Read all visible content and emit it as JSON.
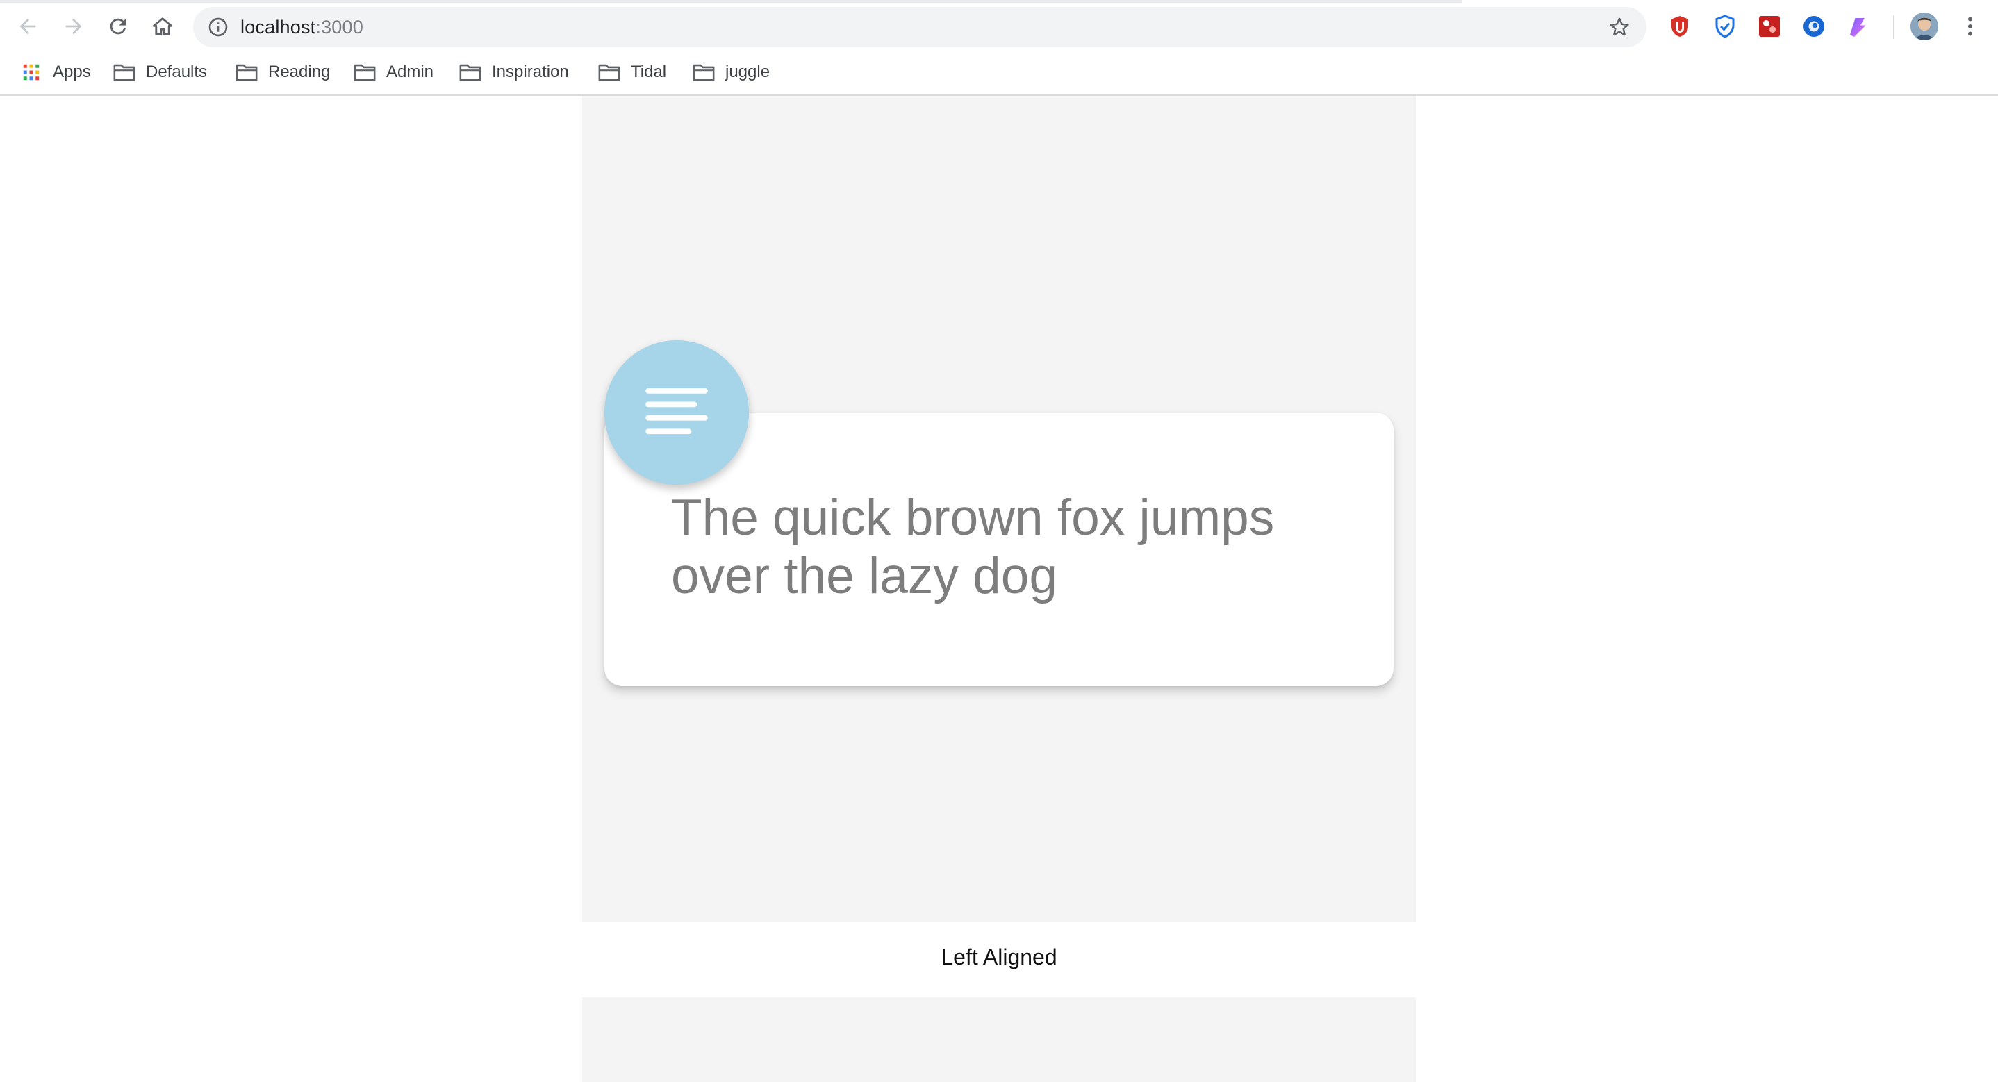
{
  "browser": {
    "url_host": "localhost",
    "url_port": ":3000",
    "icons": {
      "back": "arrow-left-icon",
      "forward": "arrow-right-icon",
      "reload": "reload-icon",
      "home": "home-icon",
      "info": "info-icon",
      "bookmark_star": "star-icon",
      "menu": "kebab-menu-icon"
    },
    "extensions": [
      {
        "name": "ublock-extension-icon",
        "color": "#d93025"
      },
      {
        "name": "shield-extension-icon",
        "color": "#1a73e8"
      },
      {
        "name": "red-square-extension-icon",
        "color": "#c5221f"
      },
      {
        "name": "eye-extension-icon",
        "color": "#1967d2"
      },
      {
        "name": "gradient-extension-icon",
        "color": "#a142f4"
      }
    ]
  },
  "bookmarks": [
    {
      "label": "Apps",
      "icon": "apps-grid-icon"
    },
    {
      "label": "Defaults",
      "icon": "folder-icon"
    },
    {
      "label": "Reading",
      "icon": "folder-icon"
    },
    {
      "label": "Admin",
      "icon": "folder-icon"
    },
    {
      "label": "Inspiration",
      "icon": "folder-icon"
    },
    {
      "label": "Tidal",
      "icon": "folder-icon"
    },
    {
      "label": "juggle",
      "icon": "folder-icon"
    }
  ],
  "page": {
    "card_text": "The quick brown fox jumps over the lazy dog",
    "fab_icon": "text-align-left-icon",
    "caption": "Left Aligned",
    "colors": {
      "panel_bg": "#f4f4f4",
      "fab_bg": "#a6d4e8",
      "card_text": "#7d7d7d"
    }
  }
}
